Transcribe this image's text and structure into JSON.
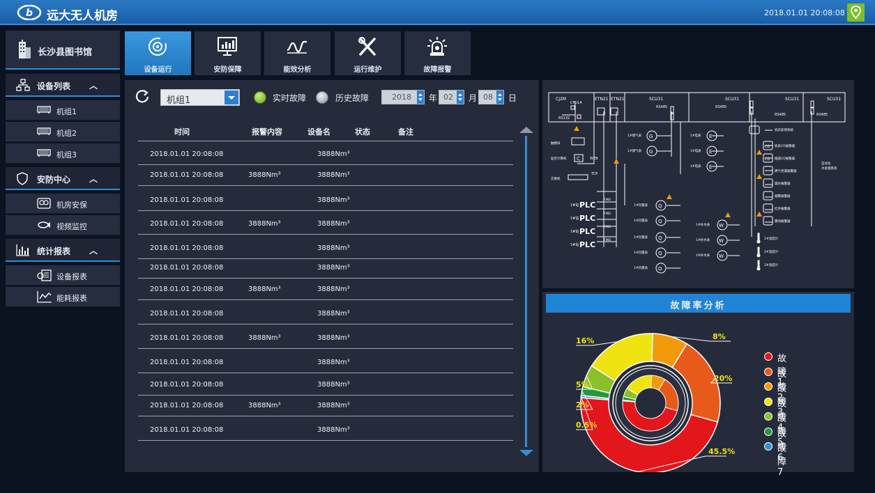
{
  "header": {
    "title": "远大无人机房",
    "datetime": "2018.01.01   20:08:08"
  },
  "sidebar": {
    "site": "长沙县图书馆",
    "sections": [
      {
        "label": "设备列表",
        "items": [
          "机组1",
          "机组2",
          "机组3"
        ]
      },
      {
        "label": "安防中心",
        "items": [
          "机房安保",
          "视频监控"
        ]
      },
      {
        "label": "统计报表",
        "items": [
          "设备报表",
          "能耗报表"
        ]
      }
    ]
  },
  "tabs": [
    "设备运行",
    "安防保障",
    "能效分析",
    "运行维护",
    "故障报警"
  ],
  "filter": {
    "unit": "机组1",
    "realtime_label": "实时故障",
    "history_label": "历史故障",
    "year": "2018",
    "year_label": "年",
    "month": "02",
    "month_label": "月",
    "day": "08",
    "day_label": "日"
  },
  "table": {
    "headers": [
      "时间",
      "报警内容",
      "设备名",
      "状态",
      "备注"
    ],
    "rows": [
      {
        "time": "2018.01.01   20:08:08",
        "content": "",
        "device": "3888Nm³"
      },
      {
        "time": "2018.01.01   20:08:08",
        "content": "3888Nm³",
        "device": "3888Nm³"
      },
      {
        "time": "2018.01.01   20:08:08",
        "content": "",
        "device": "3888Nm³"
      },
      {
        "time": "2018.01.01   20:08:08",
        "content": "3888Nm³",
        "device": "3888Nm³"
      },
      {
        "time": "2018.01.01   20:08:08",
        "content": "",
        "device": "3888Nm³"
      },
      {
        "time": "2018.01.01   20:08:08",
        "content": "",
        "device": "3888Nm³"
      },
      {
        "time": "2018.01.01   20:08:08",
        "content": "3888Nm³",
        "device": "3888Nm³"
      },
      {
        "time": "2018.01.01   20:08:08",
        "content": "",
        "device": "3888Nm³"
      },
      {
        "time": "2018.01.01   20:08:08",
        "content": "3888Nm³",
        "device": "3888Nm³"
      },
      {
        "time": "2018.01.01   20:08:08",
        "content": "",
        "device": "3888Nm³"
      },
      {
        "time": "2018.01.01   20:08:08",
        "content": "",
        "device": "3888Nm³"
      },
      {
        "time": "2018.01.01   20:08:08",
        "content": "3888Nm³",
        "device": "3888Nm³"
      },
      {
        "time": "2018.01.01   20:08:08",
        "content": "",
        "device": "3888Nm³"
      }
    ]
  },
  "diagram": {
    "cj2m": "CJ2M",
    "cpu14": "CPU14",
    "rs132": "RS132",
    "etn21a": "ETN21",
    "etn21b": "ETN21",
    "scu31a": "SCU31",
    "scu31b": "SCU31",
    "scu31c": "SCU31",
    "scu31d": "SCU31",
    "rs485": "RS485",
    "web": "WEB",
    "tcp": "TCP",
    "fins": "FINS",
    "plc": "PLC",
    "plc_prefix": "1#站",
    "host": "触摸屏",
    "monitor": "监控计算机",
    "switch": "交换机",
    "gas": "1#燃气表",
    "elec": "1#电表",
    "heat": "1#热量表",
    "water": "1#补水表",
    "temp": "1#温度计",
    "temp2": "2#温度计",
    "temp3": "3#温度计",
    "security": "机房安保系统",
    "co1": "机房CO报警器",
    "co2": "烟道CO报警器",
    "gasalarm": "燃气泄漏报警器",
    "flood": "漏水报警器",
    "smoke": "烟雾报警器",
    "ir": "红外报警器",
    "vib": "震动报警器",
    "auto": "自动化",
    "water_sys": "水处理系统",
    "co": "CO",
    "g": "G",
    "e": "E",
    "q": "Q",
    "w": "W",
    "c": "C"
  },
  "chart_data": {
    "type": "pie",
    "title": "故障率分析",
    "categories": [
      "故障1",
      "故障2",
      "故障3",
      "故障4",
      "故障5",
      "故障6",
      "故障7"
    ],
    "values": [
      45.5,
      20,
      8,
      16,
      5,
      2,
      0.5
    ],
    "labels": [
      "45.5%",
      "20%",
      "8%",
      "16%",
      "5%",
      "2%",
      "0.5%"
    ],
    "colors": [
      "#e3161c",
      "#e85a1a",
      "#f39a0c",
      "#f0e312",
      "#8cc02a",
      "#1f9a3a",
      "#2f8fd8"
    ],
    "legend": "right"
  }
}
